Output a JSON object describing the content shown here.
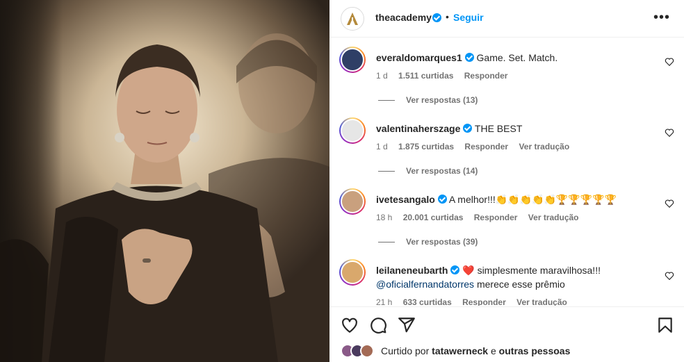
{
  "header": {
    "username": "theacademy",
    "follow_label": "Seguir",
    "dot": "•",
    "more_label": "•••"
  },
  "comments": [
    {
      "username": "everaldomarques1",
      "text": "Game. Set. Match.",
      "time": "1 d",
      "likes": "1.511 curtidas",
      "reply_label": "Responder",
      "translate_label": "",
      "view_replies": "Ver respostas (13)",
      "avatar_color": "#2f3f66"
    },
    {
      "username": "valentinaherszage",
      "text": "THE BEST",
      "time": "1 d",
      "likes": "1.875 curtidas",
      "reply_label": "Responder",
      "translate_label": "Ver tradução",
      "view_replies": "Ver respostas (14)",
      "avatar_color": "#5a5a5a"
    },
    {
      "username": "ivetesangalo",
      "text": "A melhor!!!👏👏👏👏👏🏆🏆🏆🏆🏆",
      "time": "18 h",
      "likes": "20.001 curtidas",
      "reply_label": "Responder",
      "translate_label": "Ver tradução",
      "view_replies": "Ver respostas (39)",
      "avatar_color": "#c9a07e"
    },
    {
      "username": "leilaneneubarth",
      "text": "❤️ simplesmente maravilhosa!!!",
      "mention": "@oficialfernandatorres",
      "text2": " merece esse prêmio",
      "time": "21 h",
      "likes": "633 curtidas",
      "reply_label": "Responder",
      "translate_label": "Ver tradução",
      "avatar_color": "#d9a86c"
    }
  ],
  "liked_by": {
    "prefix": "Curtido por",
    "user": "tatawerneck",
    "connector": "e",
    "others": "outras pessoas"
  },
  "colors": {
    "accent": "#0095f6",
    "text": "#262626",
    "secondary": "#737373",
    "logo_gold": "#b48a3c"
  },
  "icons": [
    "heart-icon",
    "comment-icon",
    "share-icon",
    "bookmark-icon",
    "more-icon",
    "verified-icon"
  ]
}
